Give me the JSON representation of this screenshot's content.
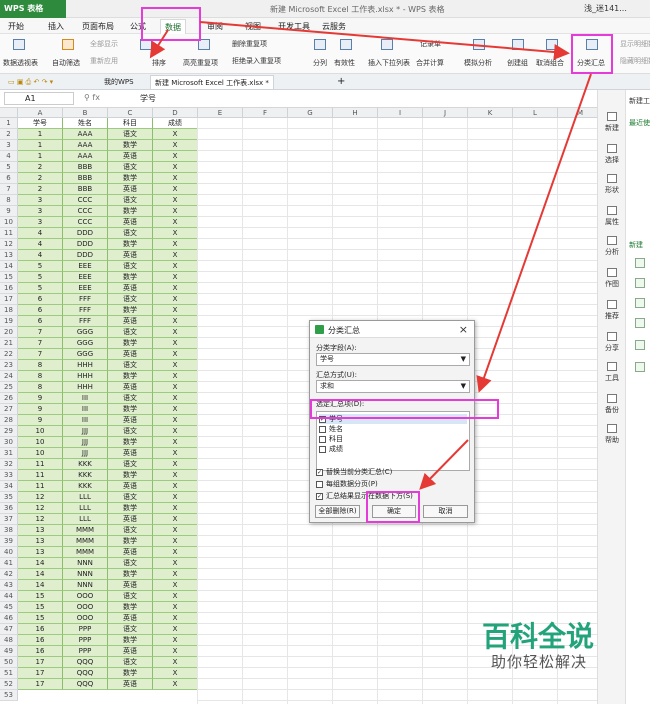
{
  "app": {
    "logo": "WPS 表格",
    "title": "新建 Microsoft Excel 工作表.xlsx * - WPS 表格",
    "user": "浅_迷141..."
  },
  "menus": [
    "开始",
    "插入",
    "页面布局",
    "公式",
    "数据",
    "审阅",
    "视图",
    "开发工具",
    "云服务"
  ],
  "ribbon": {
    "items": [
      "数据透视表",
      "自动筛选",
      "全部显示",
      "重新应用",
      "排序",
      "高亮重复项",
      "删除重复项",
      "拒绝录入重复项",
      "分列",
      "有效性",
      "插入下拉列表",
      "记录单",
      "合并计算",
      "模拟分析",
      "创建组",
      "取消组合",
      "分类汇总",
      "显示明细数据",
      "隐藏明细数据"
    ]
  },
  "tabs": {
    "mywps": "我的WPS",
    "doc": "新建 Microsoft Excel 工作表.xlsx *",
    "add": "+"
  },
  "formula": {
    "cell": "A1",
    "fx": "fx",
    "value": "学号"
  },
  "columns": [
    "A",
    "B",
    "C",
    "D",
    "E",
    "F",
    "G",
    "H",
    "I",
    "J",
    "K",
    "L",
    "M"
  ],
  "table": {
    "headers": [
      "学号",
      "姓名",
      "科目",
      "成绩"
    ],
    "rows": [
      [
        "1",
        "AAA",
        "语文",
        "X"
      ],
      [
        "1",
        "AAA",
        "数学",
        "X"
      ],
      [
        "1",
        "AAA",
        "英语",
        "X"
      ],
      [
        "2",
        "BBB",
        "语文",
        "X"
      ],
      [
        "2",
        "BBB",
        "数学",
        "X"
      ],
      [
        "2",
        "BBB",
        "英语",
        "X"
      ],
      [
        "3",
        "CCC",
        "语文",
        "X"
      ],
      [
        "3",
        "CCC",
        "数学",
        "X"
      ],
      [
        "3",
        "CCC",
        "英语",
        "X"
      ],
      [
        "4",
        "DDD",
        "语文",
        "X"
      ],
      [
        "4",
        "DDD",
        "数学",
        "X"
      ],
      [
        "4",
        "DDD",
        "英语",
        "X"
      ],
      [
        "5",
        "EEE",
        "语文",
        "X"
      ],
      [
        "5",
        "EEE",
        "数学",
        "X"
      ],
      [
        "5",
        "EEE",
        "英语",
        "X"
      ],
      [
        "6",
        "FFF",
        "语文",
        "X"
      ],
      [
        "6",
        "FFF",
        "数学",
        "X"
      ],
      [
        "6",
        "FFF",
        "英语",
        "X"
      ],
      [
        "7",
        "GGG",
        "语文",
        "X"
      ],
      [
        "7",
        "GGG",
        "数学",
        "X"
      ],
      [
        "7",
        "GGG",
        "英语",
        "X"
      ],
      [
        "8",
        "HHH",
        "语文",
        "X"
      ],
      [
        "8",
        "HHH",
        "数学",
        "X"
      ],
      [
        "8",
        "HHH",
        "英语",
        "X"
      ],
      [
        "9",
        "III",
        "语文",
        "X"
      ],
      [
        "9",
        "III",
        "数学",
        "X"
      ],
      [
        "9",
        "III",
        "英语",
        "X"
      ],
      [
        "10",
        "JJJ",
        "语文",
        "X"
      ],
      [
        "10",
        "JJJ",
        "数学",
        "X"
      ],
      [
        "10",
        "JJJ",
        "英语",
        "X"
      ],
      [
        "11",
        "KKK",
        "语文",
        "X"
      ],
      [
        "11",
        "KKK",
        "数学",
        "X"
      ],
      [
        "11",
        "KKK",
        "英语",
        "X"
      ],
      [
        "12",
        "LLL",
        "语文",
        "X"
      ],
      [
        "12",
        "LLL",
        "数学",
        "X"
      ],
      [
        "12",
        "LLL",
        "英语",
        "X"
      ],
      [
        "13",
        "MMM",
        "语文",
        "X"
      ],
      [
        "13",
        "MMM",
        "数学",
        "X"
      ],
      [
        "13",
        "MMM",
        "英语",
        "X"
      ],
      [
        "14",
        "NNN",
        "语文",
        "X"
      ],
      [
        "14",
        "NNN",
        "数学",
        "X"
      ],
      [
        "14",
        "NNN",
        "英语",
        "X"
      ],
      [
        "15",
        "OOO",
        "语文",
        "X"
      ],
      [
        "15",
        "OOO",
        "数学",
        "X"
      ],
      [
        "15",
        "OOO",
        "英语",
        "X"
      ],
      [
        "16",
        "PPP",
        "语文",
        "X"
      ],
      [
        "16",
        "PPP",
        "数学",
        "X"
      ],
      [
        "16",
        "PPP",
        "英语",
        "X"
      ],
      [
        "17",
        "QQQ",
        "语文",
        "X"
      ],
      [
        "17",
        "QQQ",
        "数学",
        "X"
      ],
      [
        "17",
        "QQQ",
        "英语",
        "X"
      ]
    ]
  },
  "sidepanel": [
    "新建",
    "选择",
    "形状",
    "属性",
    "分析",
    "作图",
    "推荐",
    "分享",
    "工具",
    "备份",
    "帮助"
  ],
  "rightpanel": {
    "title": "新建工",
    "recent": "最近使",
    "new": "新建"
  },
  "dialog": {
    "title": "分类汇总",
    "field_label": "分类字段(A):",
    "field_value": "学号",
    "method_label": "汇总方式(U):",
    "method_value": "求和",
    "items_label": "选定汇总项(D):",
    "items": [
      {
        "label": "学号",
        "checked": true
      },
      {
        "label": "姓名",
        "checked": false
      },
      {
        "label": "科目",
        "checked": false
      },
      {
        "label": "成绩",
        "checked": false
      }
    ],
    "options": [
      {
        "label": "替换当前分类汇总(C)",
        "checked": true
      },
      {
        "label": "每组数据分页(P)",
        "checked": false
      },
      {
        "label": "汇总结果显示在数据下方(S)",
        "checked": true
      }
    ],
    "btn_remove": "全部删除(R)",
    "btn_ok": "确定",
    "btn_cancel": "取消"
  },
  "watermark": {
    "line1": "百科全说",
    "line2": "助你轻松解决"
  },
  "colors": {
    "accent": "#2e8b3e",
    "annotation": "#e53bd8",
    "arrow": "#e53935",
    "selection": "#dfeecd"
  }
}
